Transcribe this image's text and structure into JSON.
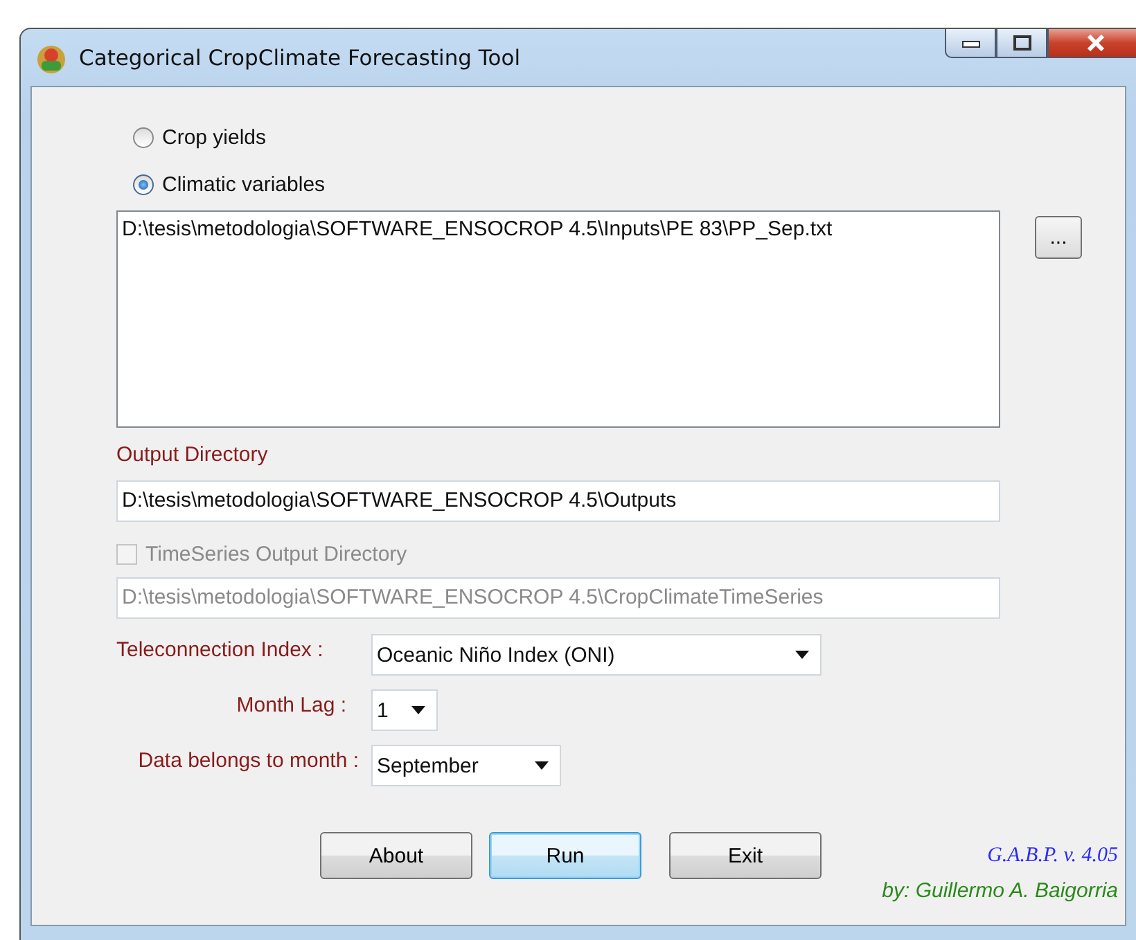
{
  "window": {
    "title": "Categorical CropClimate Forecasting Tool"
  },
  "source": {
    "options": [
      {
        "label": "Crop yields",
        "selected": false
      },
      {
        "label": "Climatic variables",
        "selected": true
      }
    ],
    "files": [
      "D:\\tesis\\metodologia\\SOFTWARE_ENSOCROP 4.5\\Inputs\\PE 83\\PP_Sep.txt"
    ],
    "browse_button": "..."
  },
  "output_directory": {
    "label": "Output Directory",
    "value": "D:\\tesis\\metodologia\\SOFTWARE_ENSOCROP 4.5\\Outputs"
  },
  "timeseries": {
    "label": "TimeSeries Output Directory",
    "checked": false,
    "disabled": true,
    "value": "D:\\tesis\\metodologia\\SOFTWARE_ENSOCROP 4.5\\CropClimateTimeSeries"
  },
  "settings": [
    {
      "label": "Teleconnection Index :",
      "value": "Oceanic Niño Index (ONI)"
    },
    {
      "label": "Month Lag :",
      "value": "1"
    },
    {
      "label": "Data belongs to month :",
      "value": "September"
    }
  ],
  "buttons": [
    {
      "label": "About",
      "focused": false
    },
    {
      "label": "Run",
      "focused": true
    },
    {
      "label": "Exit",
      "focused": false
    }
  ],
  "credits": {
    "version": "G.A.B.P. v. 4.05",
    "author": "by: Guillermo A. Baigorria"
  }
}
